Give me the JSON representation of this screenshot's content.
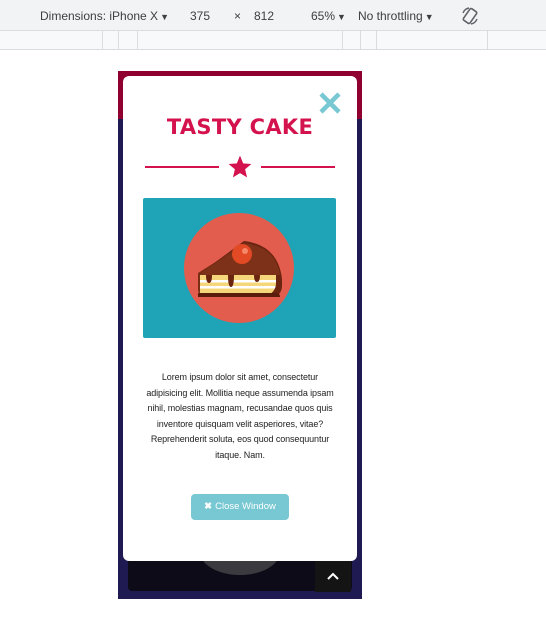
{
  "devtools": {
    "dimensions_label": "Dimensions: iPhone X",
    "width": "375",
    "times": "×",
    "height": "812",
    "zoom": "65%",
    "throttling": "No throttling"
  },
  "popup": {
    "title": "TASTY CAKE",
    "body": "Lorem ipsum dolor sit amet, consectetur adipisicing elit. Mollitia neque assumenda ipsam nihil, molestias magnam, recusandae quos quis inventore quisquam velit asperiores, vitae? Reprehenderit soluta, eos quod consequuntur itaque. Nam.",
    "close_button_icon": "✖",
    "close_button_label": "Close Window"
  },
  "page": {
    "scroll_top_icon": "^"
  },
  "colors": {
    "accent": "#d4124d",
    "teal": "#1fa3b6",
    "button": "#77c8d2",
    "close_x": "#77c8d2",
    "page_bg": "#1f1a52",
    "header_band": "#8f0030"
  },
  "icons": [
    "close-icon",
    "star-icon",
    "cake-slice-icon",
    "rotate-icon",
    "chevron-up-icon"
  ]
}
